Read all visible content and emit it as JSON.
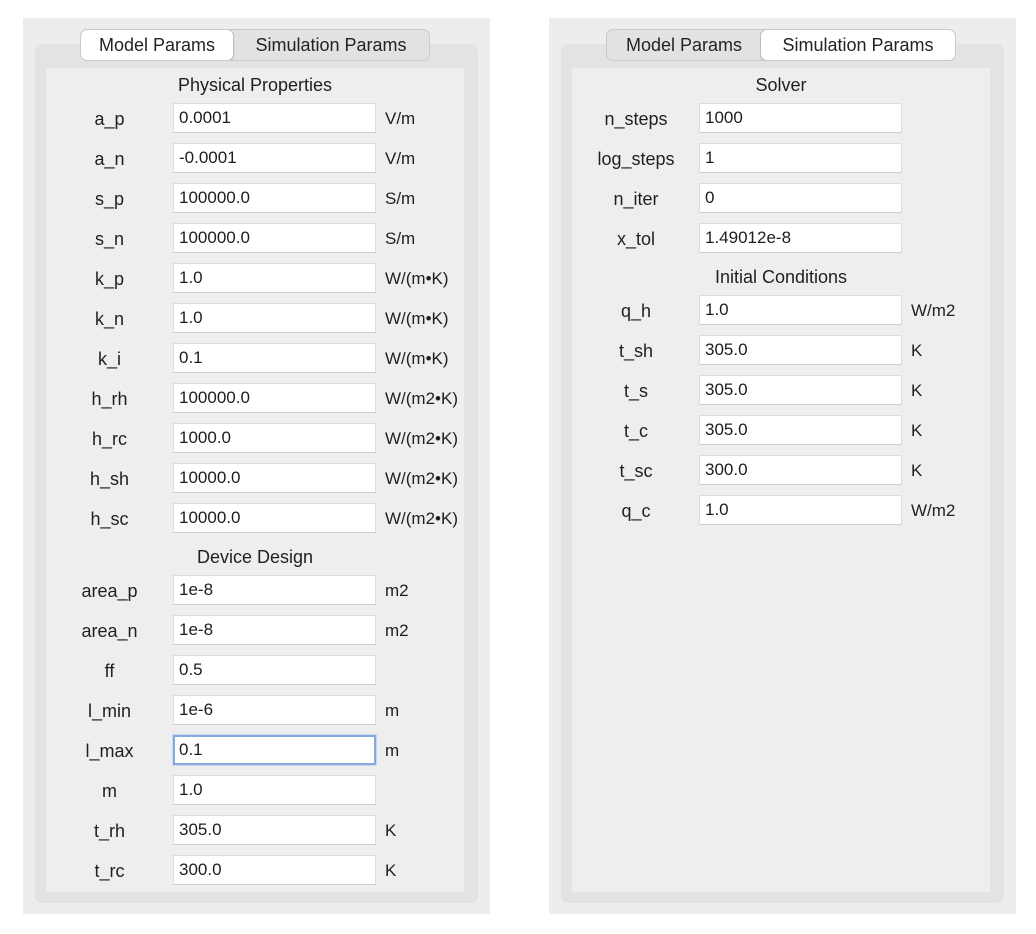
{
  "left_panel": {
    "tabs": [
      {
        "label": "Model Params",
        "active": true
      },
      {
        "label": "Simulation Params",
        "active": false
      }
    ],
    "sections": {
      "physical": "Physical Properties",
      "device": "Device Design"
    },
    "physical_rows": [
      {
        "label": "a_p",
        "value": "0.0001",
        "unit": "V/m"
      },
      {
        "label": "a_n",
        "value": "-0.0001",
        "unit": "V/m"
      },
      {
        "label": "s_p",
        "value": "100000.0",
        "unit": "S/m"
      },
      {
        "label": "s_n",
        "value": "100000.0",
        "unit": "S/m"
      },
      {
        "label": "k_p",
        "value": "1.0",
        "unit": "W/(m•K)"
      },
      {
        "label": "k_n",
        "value": "1.0",
        "unit": "W/(m•K)"
      },
      {
        "label": "k_i",
        "value": "0.1",
        "unit": "W/(m•K)"
      },
      {
        "label": "h_rh",
        "value": "100000.0",
        "unit": "W/(m2•K)"
      },
      {
        "label": "h_rc",
        "value": "1000.0",
        "unit": "W/(m2•K)"
      },
      {
        "label": "h_sh",
        "value": "10000.0",
        "unit": "W/(m2•K)"
      },
      {
        "label": "h_sc",
        "value": "10000.0",
        "unit": "W/(m2•K)"
      }
    ],
    "device_rows": [
      {
        "label": "area_p",
        "value": "1e-8",
        "unit": "m2"
      },
      {
        "label": "area_n",
        "value": "1e-8",
        "unit": "m2"
      },
      {
        "label": "ff",
        "value": "0.5",
        "unit": ""
      },
      {
        "label": "l_min",
        "value": "1e-6",
        "unit": "m"
      },
      {
        "label": "l_max",
        "value": "0.1",
        "unit": "m"
      },
      {
        "label": "m",
        "value": "1.0",
        "unit": ""
      },
      {
        "label": "t_rh",
        "value": "305.0",
        "unit": "K"
      },
      {
        "label": "t_rc",
        "value": "300.0",
        "unit": "K"
      }
    ]
  },
  "right_panel": {
    "tabs": [
      {
        "label": "Model Params",
        "active": false
      },
      {
        "label": "Simulation Params",
        "active": true
      }
    ],
    "sections": {
      "solver": "Solver",
      "initial": "Initial Conditions"
    },
    "solver_rows": [
      {
        "label": "n_steps",
        "value": "1000",
        "unit": ""
      },
      {
        "label": "log_steps",
        "value": "1",
        "unit": ""
      },
      {
        "label": "n_iter",
        "value": "0",
        "unit": ""
      },
      {
        "label": "x_tol",
        "value": "1.49012e-8",
        "unit": ""
      }
    ],
    "initial_rows": [
      {
        "label": "q_h",
        "value": "1.0",
        "unit": "W/m2"
      },
      {
        "label": "t_sh",
        "value": "305.0",
        "unit": "K"
      },
      {
        "label": "t_s",
        "value": "305.0",
        "unit": "K"
      },
      {
        "label": "t_c",
        "value": "305.0",
        "unit": "K"
      },
      {
        "label": "t_sc",
        "value": "300.0",
        "unit": "K"
      },
      {
        "label": "q_c",
        "value": "1.0",
        "unit": "W/m2"
      }
    ]
  }
}
